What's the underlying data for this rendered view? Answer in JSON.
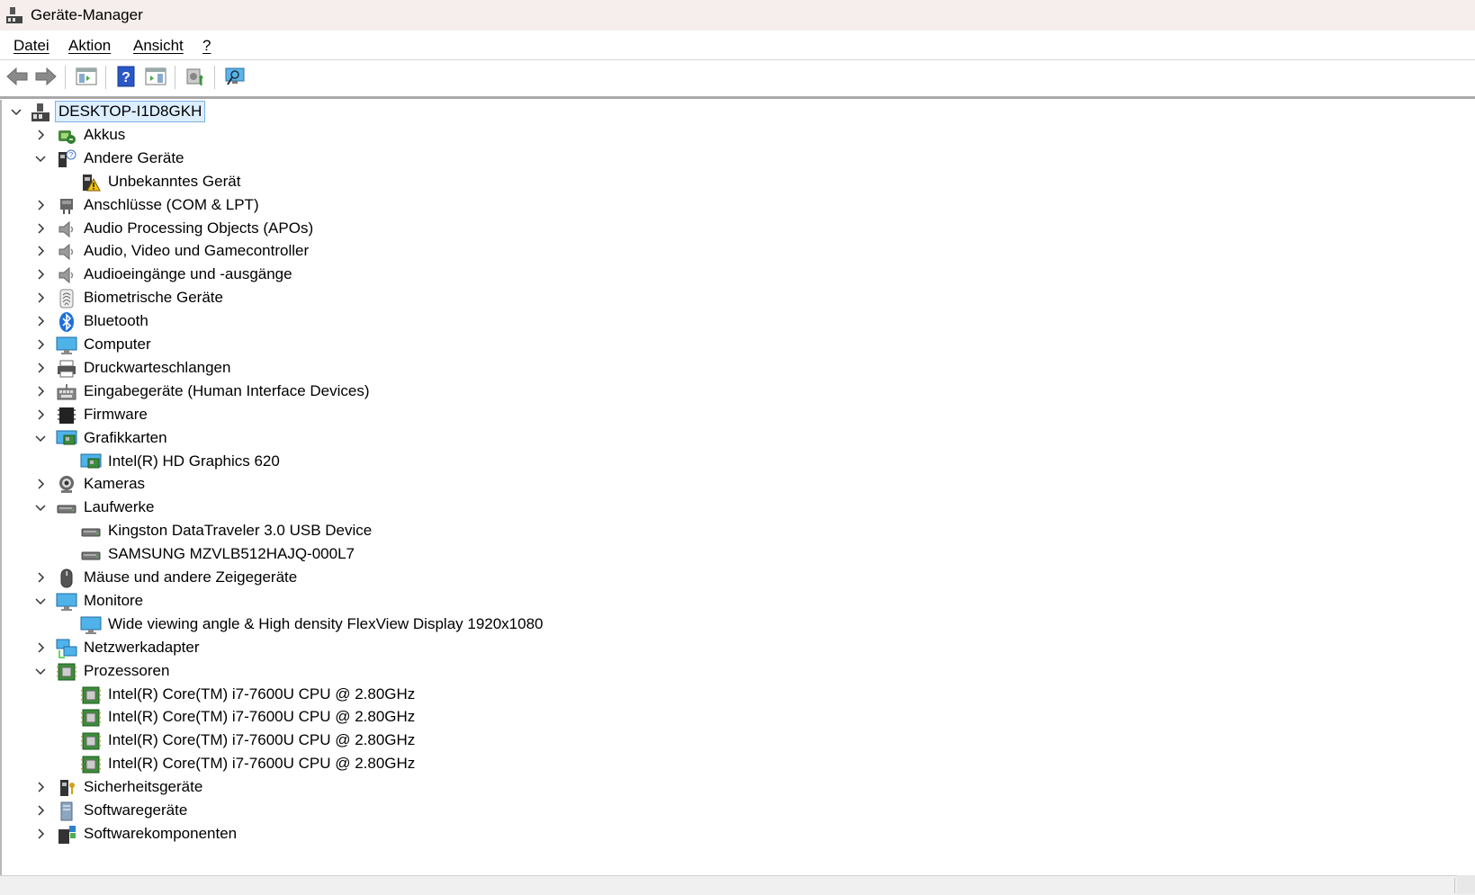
{
  "window": {
    "title": "Geräte-Manager"
  },
  "menu": {
    "items": [
      "Datei",
      "Aktion",
      "Ansicht",
      "?"
    ]
  },
  "toolbar": {
    "buttons": [
      "back-icon",
      "forward-icon",
      "show-hide-console-tree-icon",
      "help-icon",
      "action-pane-icon",
      "update-driver-icon",
      "scan-hardware-icon"
    ]
  },
  "tree": {
    "root": "DESKTOP-I1D8GKH",
    "nodes": [
      {
        "label": "Akkus",
        "level": 1,
        "expanded": false,
        "icon": "battery-icon"
      },
      {
        "label": "Andere Geräte",
        "level": 1,
        "expanded": true,
        "icon": "other-devices-icon"
      },
      {
        "label": "Unbekanntes Gerät",
        "level": 2,
        "icon": "unknown-device-warning-icon"
      },
      {
        "label": "Anschlüsse (COM & LPT)",
        "level": 1,
        "expanded": false,
        "icon": "port-icon"
      },
      {
        "label": "Audio Processing Objects (APOs)",
        "level": 1,
        "expanded": false,
        "icon": "speaker-icon"
      },
      {
        "label": "Audio, Video und Gamecontroller",
        "level": 1,
        "expanded": false,
        "icon": "speaker-icon"
      },
      {
        "label": "Audioeingänge und -ausgänge",
        "level": 1,
        "expanded": false,
        "icon": "speaker-icon"
      },
      {
        "label": "Biometrische Geräte",
        "level": 1,
        "expanded": false,
        "icon": "fingerprint-icon"
      },
      {
        "label": "Bluetooth",
        "level": 1,
        "expanded": false,
        "icon": "bluetooth-icon"
      },
      {
        "label": "Computer",
        "level": 1,
        "expanded": false,
        "icon": "computer-icon"
      },
      {
        "label": "Druckwarteschlangen",
        "level": 1,
        "expanded": false,
        "icon": "printer-icon"
      },
      {
        "label": "Eingabegeräte (Human Interface Devices)",
        "level": 1,
        "expanded": false,
        "icon": "hid-icon"
      },
      {
        "label": "Firmware",
        "level": 1,
        "expanded": false,
        "icon": "firmware-icon"
      },
      {
        "label": "Grafikkarten",
        "level": 1,
        "expanded": true,
        "icon": "display-adapter-icon"
      },
      {
        "label": "Intel(R) HD Graphics 620",
        "level": 2,
        "icon": "display-adapter-icon"
      },
      {
        "label": "Kameras",
        "level": 1,
        "expanded": false,
        "icon": "camera-icon"
      },
      {
        "label": "Laufwerke",
        "level": 1,
        "expanded": true,
        "icon": "drive-icon"
      },
      {
        "label": "Kingston DataTraveler 3.0 USB Device",
        "level": 2,
        "icon": "drive-icon"
      },
      {
        "label": "SAMSUNG MZVLB512HAJQ-000L7",
        "level": 2,
        "icon": "drive-icon"
      },
      {
        "label": "Mäuse und andere Zeigegeräte",
        "level": 1,
        "expanded": false,
        "icon": "mouse-icon"
      },
      {
        "label": "Monitore",
        "level": 1,
        "expanded": true,
        "icon": "monitor-icon"
      },
      {
        "label": "Wide viewing angle & High density FlexView Display 1920x1080",
        "level": 2,
        "icon": "monitor-icon"
      },
      {
        "label": "Netzwerkadapter",
        "level": 1,
        "expanded": false,
        "icon": "network-icon"
      },
      {
        "label": "Prozessoren",
        "level": 1,
        "expanded": true,
        "icon": "processor-icon"
      },
      {
        "label": "Intel(R) Core(TM) i7-7600U CPU @ 2.80GHz",
        "level": 2,
        "icon": "processor-icon"
      },
      {
        "label": "Intel(R) Core(TM) i7-7600U CPU @ 2.80GHz",
        "level": 2,
        "icon": "processor-icon"
      },
      {
        "label": "Intel(R) Core(TM) i7-7600U CPU @ 2.80GHz",
        "level": 2,
        "icon": "processor-icon"
      },
      {
        "label": "Intel(R) Core(TM) i7-7600U CPU @ 2.80GHz",
        "level": 2,
        "icon": "processor-icon"
      },
      {
        "label": "Sicherheitsgeräte",
        "level": 1,
        "expanded": false,
        "icon": "security-icon"
      },
      {
        "label": "Softwaregeräte",
        "level": 1,
        "expanded": false,
        "icon": "software-device-icon"
      },
      {
        "label": "Softwarekomponenten",
        "level": 1,
        "expanded": false,
        "icon": "software-component-icon"
      }
    ]
  }
}
